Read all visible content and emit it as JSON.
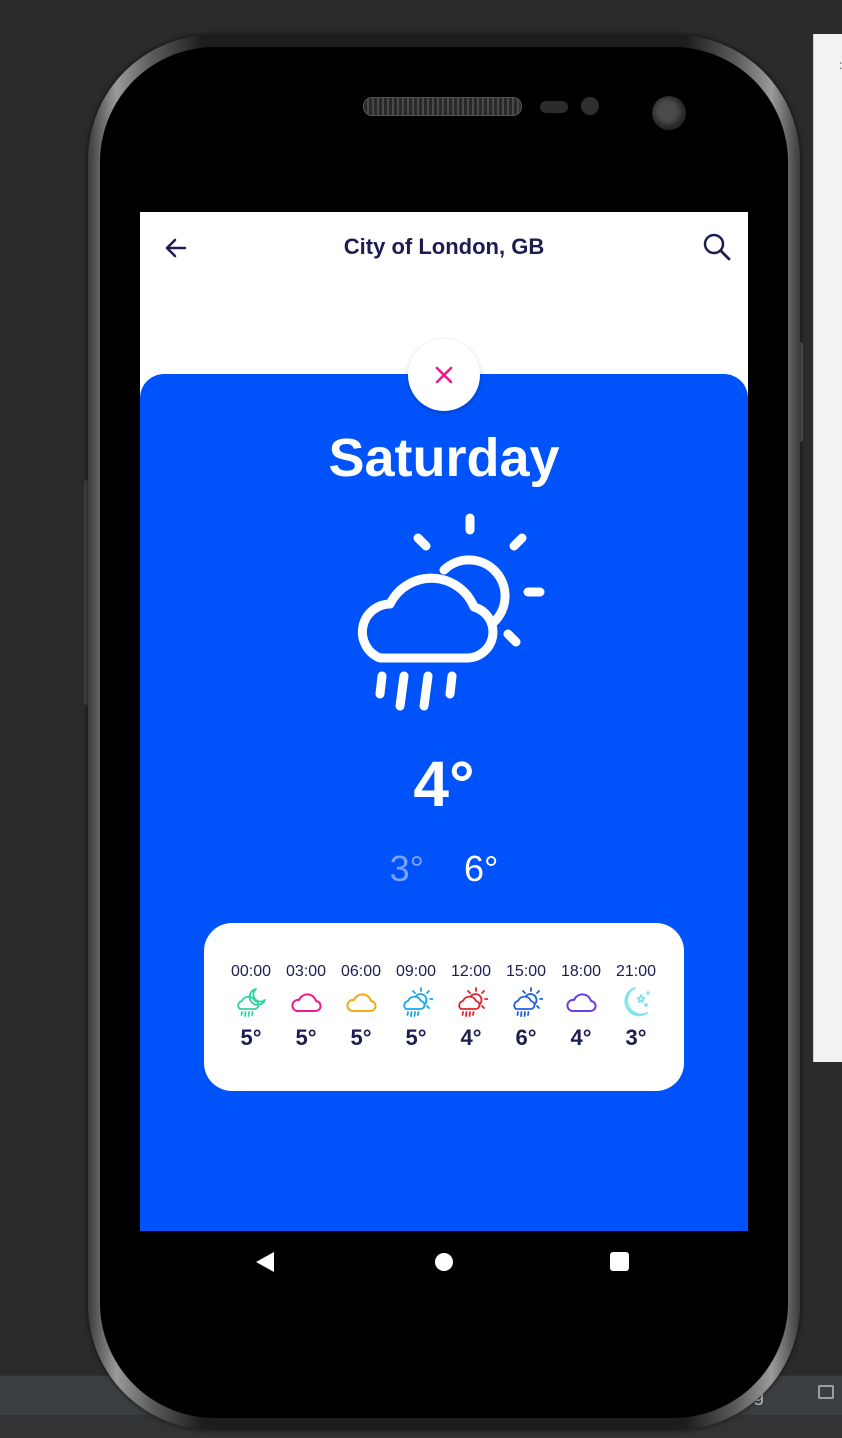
{
  "ide": {
    "bottom_tab_text": "og"
  },
  "app_bar": {
    "title": "City of London, GB",
    "back_icon": "arrow-left-icon",
    "search_icon": "search-icon"
  },
  "detail": {
    "close_icon": "close-icon",
    "day": "Saturday",
    "weather_icon": "cloud-sun-rain-icon",
    "current_temp": "4°",
    "min_temp": "3°",
    "max_temp": "6°"
  },
  "hourly": [
    {
      "time": "00:00",
      "icon": "moon-cloud-rain-icon",
      "color": "#2fd3a0",
      "temp": "5°"
    },
    {
      "time": "03:00",
      "icon": "cloud-icon",
      "color": "#ee1c8c",
      "temp": "5°"
    },
    {
      "time": "06:00",
      "icon": "cloud-icon",
      "color": "#f5a818",
      "temp": "5°"
    },
    {
      "time": "09:00",
      "icon": "cloud-sun-rain-icon",
      "color": "#1ba6e8",
      "temp": "5°"
    },
    {
      "time": "12:00",
      "icon": "cloud-sun-rain-icon",
      "color": "#e0242c",
      "temp": "4°"
    },
    {
      "time": "15:00",
      "icon": "cloud-sun-rain-icon",
      "color": "#2060e0",
      "temp": "6°"
    },
    {
      "time": "18:00",
      "icon": "cloud-icon",
      "color": "#6a3ee0",
      "temp": "4°"
    },
    {
      "time": "21:00",
      "icon": "moon-stars-icon",
      "color": "#7fe3ee",
      "temp": "3°"
    }
  ],
  "colors": {
    "card_blue": "#0053fb",
    "title_navy": "#1d1d52",
    "close_pink": "#ee1c8c",
    "min_temp": "#7aa3ff"
  },
  "nav_bar": {
    "back_icon": "nav-back-icon",
    "home_icon": "nav-home-icon",
    "recents_icon": "nav-recents-icon"
  }
}
